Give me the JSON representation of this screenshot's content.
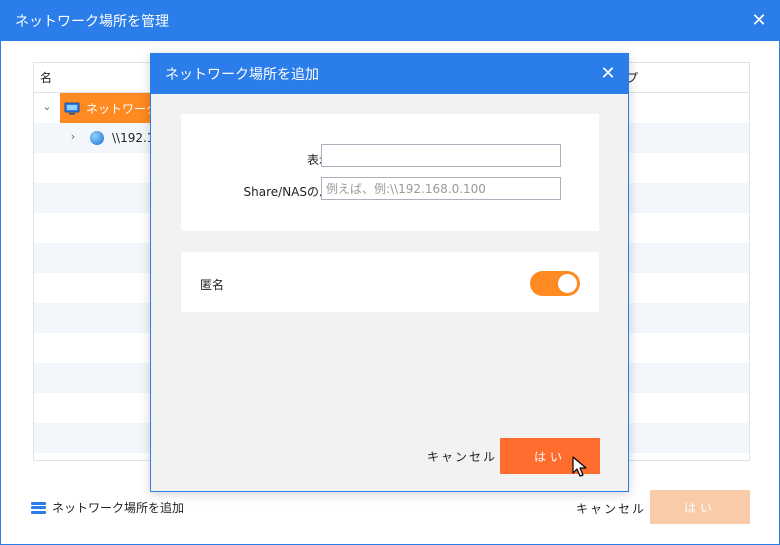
{
  "window": {
    "title": "ネットワーク場所を管理"
  },
  "table": {
    "headers": {
      "name": "名",
      "type": "プ"
    },
    "rows": [
      {
        "label": "ネットワーク"
      },
      {
        "label": "\\\\192.1"
      }
    ]
  },
  "footer": {
    "add_label": "ネットワーク場所を追加",
    "cancel_label": "キャンセル",
    "ok_label": "はい"
  },
  "modal": {
    "title": "ネットワーク場所を追加",
    "display_name_label": "表示名",
    "display_name_value": "",
    "path_label": "Share/NASのパス",
    "path_placeholder": "例えば、例:\\\\192.168.0.100",
    "anonymous_label": "匿名",
    "anonymous_on": true,
    "cancel_label": "キャンセル",
    "ok_label": "はい"
  },
  "colors": {
    "accent": "#2b7de9",
    "orange": "#ff8a22",
    "primary_button": "#ff6d2e",
    "disabled_button": "#f9cba8"
  }
}
